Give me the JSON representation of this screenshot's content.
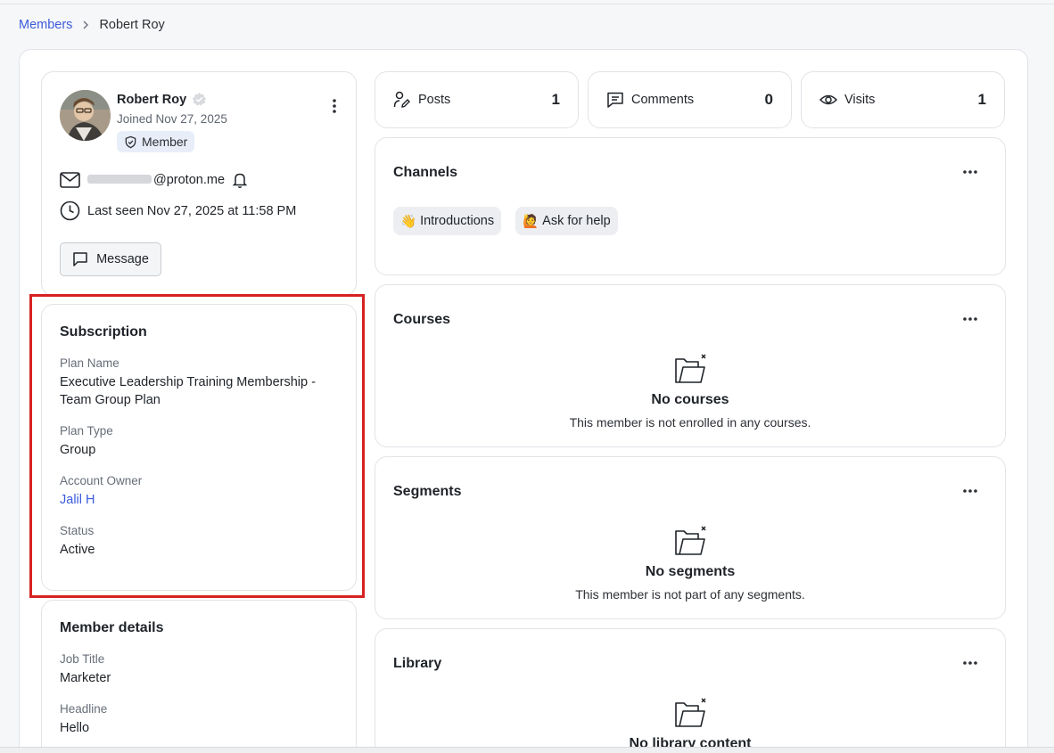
{
  "breadcrumb": {
    "parent": "Members",
    "current": "Robert Roy"
  },
  "profile": {
    "name": "Robert Roy",
    "joined": "Joined Nov 27, 2025",
    "role_badge": "Member",
    "email_domain": "@proton.me",
    "last_seen": "Last seen Nov 27, 2025 at 11:58 PM",
    "message_label": "Message"
  },
  "subscription": {
    "title": "Subscription",
    "fields": [
      {
        "label": "Plan Name",
        "value": "Executive Leadership Training Membership - Team Group Plan"
      },
      {
        "label": "Plan Type",
        "value": "Group"
      },
      {
        "label": "Account Owner",
        "value": "Jalil H"
      },
      {
        "label": "Status",
        "value": "Active"
      }
    ]
  },
  "member_details": {
    "title": "Member details",
    "fields": [
      {
        "label": "Job Title",
        "value": "Marketer"
      },
      {
        "label": "Headline",
        "value": "Hello"
      }
    ]
  },
  "stats": [
    {
      "label": "Posts",
      "value": "1",
      "icon": "posts-icon"
    },
    {
      "label": "Comments",
      "value": "0",
      "icon": "comment-icon"
    },
    {
      "label": "Visits",
      "value": "1",
      "icon": "eye-icon"
    }
  ],
  "channels": {
    "title": "Channels",
    "items": [
      {
        "emoji": "👋",
        "label": "Introductions"
      },
      {
        "emoji": "🙋",
        "label": "Ask for help"
      }
    ]
  },
  "courses": {
    "title": "Courses",
    "empty_title": "No courses",
    "empty_desc": "This member is not enrolled in any courses."
  },
  "segments": {
    "title": "Segments",
    "empty_title": "No segments",
    "empty_desc": "This member is not part of any segments."
  },
  "library": {
    "title": "Library",
    "empty_title": "No library content"
  },
  "colors": {
    "accent": "#3b5bdb",
    "highlight": "#d62222",
    "badge_bg": "#e8eef9"
  }
}
